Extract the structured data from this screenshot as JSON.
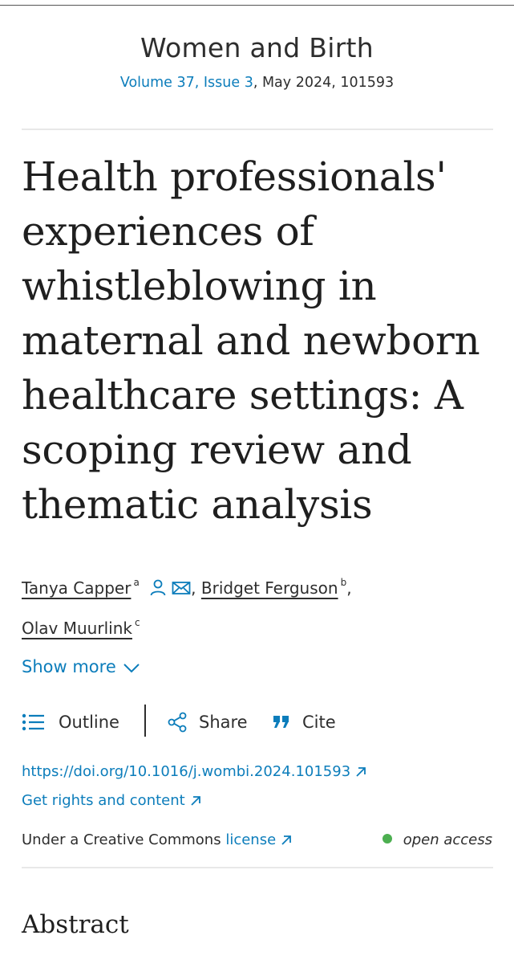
{
  "journal": {
    "name": "Women and Birth",
    "volume_issue": "Volume 37, Issue 3",
    "date_ref": ", May 2024, 101593"
  },
  "article": {
    "title": "Health professionals' experiences of whistleblowing in maternal and newborn healthcare settings: A scoping review and thematic analysis"
  },
  "authors": [
    {
      "name": "Tanya Capper",
      "sup": "a"
    },
    {
      "name": "Bridget Ferguson",
      "sup": "b"
    },
    {
      "name": "Olav Muurlink",
      "sup": "c"
    }
  ],
  "show_more_label": "Show more",
  "toolbar": {
    "outline_label": "Outline",
    "share_label": "Share",
    "cite_label": "Cite"
  },
  "links": {
    "doi": "https://doi.org/10.1016/j.wombi.2024.101593",
    "rights": "Get rights and content"
  },
  "license": {
    "prefix": "Under a Creative Commons ",
    "link": "license",
    "access": "open access"
  },
  "abstract_heading": "Abstract",
  "colors": {
    "link": "#0c7dbb",
    "open_access_dot": "#4caf50",
    "text": "#2e2e2e"
  },
  "icons": [
    "author-profile-icon",
    "email-icon",
    "chevron-down-icon",
    "outline-list-icon",
    "share-icon",
    "quote-icon",
    "external-link-icon"
  ]
}
